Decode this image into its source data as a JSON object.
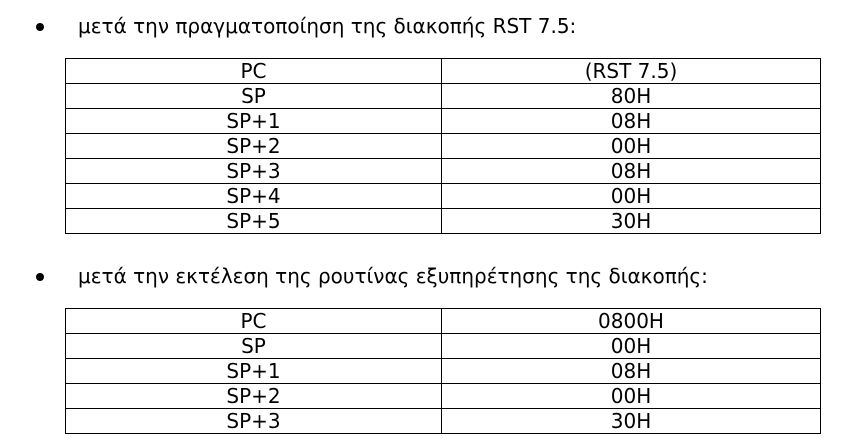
{
  "section1": {
    "bullet_text": "μετά την πραγματοποίηση της διακοπής RST 7.5:",
    "rows": [
      {
        "reg": "PC",
        "val": "(RST 7.5)"
      },
      {
        "reg": "SP",
        "val": "80H"
      },
      {
        "reg": "SP+1",
        "val": "08H"
      },
      {
        "reg": "SP+2",
        "val": "00H"
      },
      {
        "reg": "SP+3",
        "val": "08H"
      },
      {
        "reg": "SP+4",
        "val": "00H"
      },
      {
        "reg": "SP+5",
        "val": "30H"
      }
    ]
  },
  "section2": {
    "bullet_text": "μετά την εκτέλεση της ρουτίνας εξυπηρέτησης της διακοπής:",
    "rows": [
      {
        "reg": "PC",
        "val": "0800H"
      },
      {
        "reg": "SP",
        "val": "00H"
      },
      {
        "reg": "SP+1",
        "val": "08H"
      },
      {
        "reg": "SP+2",
        "val": "00H"
      },
      {
        "reg": "SP+3",
        "val": "30H"
      }
    ]
  }
}
